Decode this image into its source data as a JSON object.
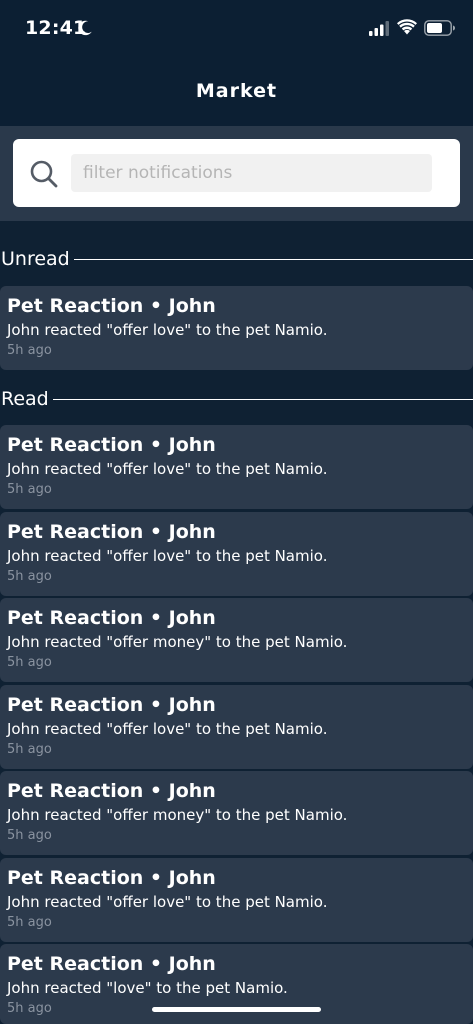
{
  "status_bar": {
    "time": "12:41",
    "moon_icon": "moon-icon",
    "signal_icon": "cellular-signal-icon",
    "wifi_icon": "wifi-icon",
    "battery_icon": "battery-icon"
  },
  "header": {
    "title": "Market"
  },
  "search": {
    "placeholder": "filter notifications",
    "value": "",
    "icon": "search-icon"
  },
  "sections": {
    "unread": {
      "label": "Unread",
      "items": [
        {
          "title": "Pet Reaction • John",
          "body": "John reacted \"offer love\" to the pet Namio.",
          "time": "5h ago"
        }
      ]
    },
    "read": {
      "label": "Read",
      "items": [
        {
          "title": "Pet Reaction • John",
          "body": "John reacted \"offer love\" to the pet Namio.",
          "time": "5h ago"
        },
        {
          "title": "Pet Reaction • John",
          "body": "John reacted \"offer love\" to the pet Namio.",
          "time": "5h ago"
        },
        {
          "title": "Pet Reaction • John",
          "body": "John reacted \"offer money\" to the pet Namio.",
          "time": "5h ago"
        },
        {
          "title": "Pet Reaction • John",
          "body": "John reacted \"offer love\" to the pet Namio.",
          "time": "5h ago"
        },
        {
          "title": "Pet Reaction • John",
          "body": "John reacted \"offer money\" to the pet Namio.",
          "time": "5h ago"
        },
        {
          "title": "Pet Reaction • John",
          "body": "John reacted \"offer love\" to the pet Namio.",
          "time": "5h ago"
        },
        {
          "title": "Pet Reaction • John",
          "body": "John reacted \"love\" to the pet Namio.",
          "time": "5h ago"
        }
      ]
    }
  },
  "colors": {
    "background": "#0f2133",
    "header": "#0c1f33",
    "card": "#2c3a4c",
    "search_band": "#2a394b",
    "muted_text": "#8a93a0"
  }
}
